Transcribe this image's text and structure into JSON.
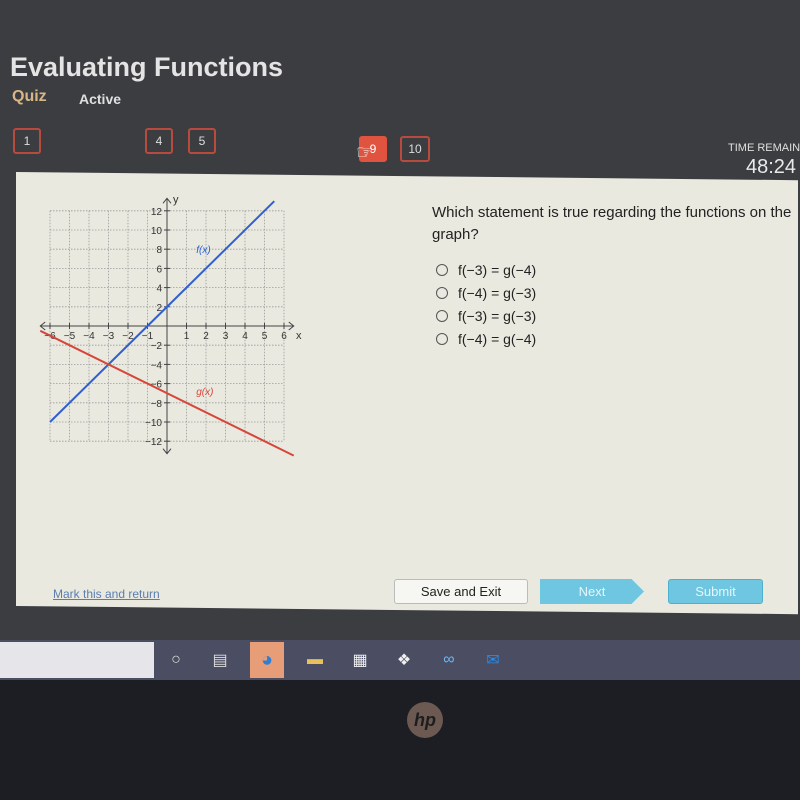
{
  "app": {
    "title": "Evaluating Functions",
    "subnav_type": "Quiz",
    "subnav_status": "Active"
  },
  "question_nav": [
    {
      "label": "1",
      "current": false
    },
    {
      "label": "4",
      "current": false
    },
    {
      "label": "5",
      "current": false
    },
    {
      "label": "9",
      "current": true
    },
    {
      "label": "10",
      "current": false
    }
  ],
  "timer": {
    "label": "TIME REMAINI",
    "value": "48:24"
  },
  "question": {
    "text": "Which statement is true regarding the functions on the graph?",
    "options": [
      "f(−3) = g(−4)",
      "f(−4) = g(−3)",
      "f(−3) = g(−3)",
      "f(−4) = g(−4)"
    ]
  },
  "chart_data": {
    "type": "line",
    "xlabel": "x",
    "ylabel": "y",
    "xlim": [
      -6,
      6
    ],
    "ylim": [
      -12,
      12
    ],
    "x_ticks": [
      -6,
      -5,
      -4,
      -3,
      -2,
      -1,
      1,
      2,
      3,
      4,
      5,
      6
    ],
    "y_ticks": [
      -12,
      -10,
      -8,
      -6,
      -4,
      -2,
      2,
      4,
      6,
      8,
      10,
      12
    ],
    "grid": true,
    "series": [
      {
        "name": "f(x)",
        "color": "#2f5fd0",
        "x": [
          -6,
          5.5
        ],
        "y": [
          -10,
          13
        ]
      },
      {
        "name": "g(x)",
        "color": "#d6463a",
        "x": [
          -6.5,
          6.5
        ],
        "y": [
          -0.5,
          -13.5
        ]
      }
    ]
  },
  "footer": {
    "mark_link": "Mark this and return",
    "save_exit": "Save and Exit",
    "next": "Next",
    "submit": "Submit"
  },
  "taskbar": {
    "icons": [
      "cortana-icon",
      "task-view-icon",
      "edge-icon",
      "file-explorer-icon",
      "store-icon",
      "dropbox-icon",
      "infinity-app-icon",
      "outlook-icon"
    ]
  },
  "laptop": {
    "brand": "hp"
  }
}
